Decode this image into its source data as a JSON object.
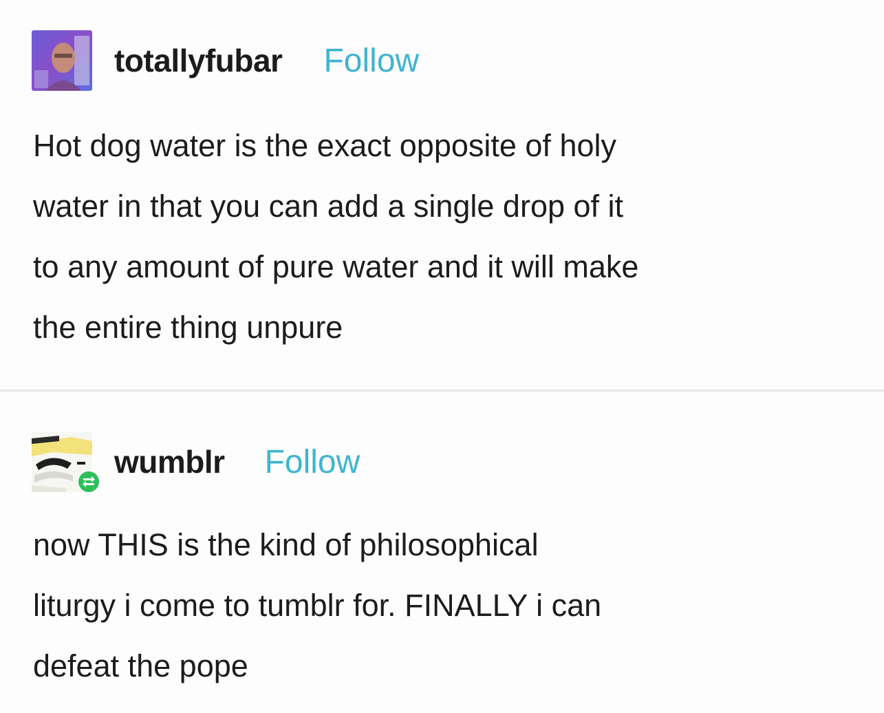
{
  "posts": [
    {
      "username": "totallyfubar",
      "follow_label": "Follow",
      "body_lines": [
        "Hot dog water is the exact opposite of holy",
        "water in that you can add a single drop of it",
        "to any amount of pure water and it will make",
        "the entire thing unpure"
      ]
    },
    {
      "username": "wumblr",
      "follow_label": "Follow",
      "body_lines": [
        "now THIS is the kind of philosophical",
        "liturgy i come to tumblr for. FINALLY i can",
        "defeat the pope"
      ]
    }
  ],
  "colors": {
    "follow": "#3fb4d0",
    "reblog_badge": "#2fbf5a",
    "background": "#fdfdfd"
  },
  "icons": {
    "post_1_avatar": "user-photo-avatar",
    "post_2_avatar": "cartoon-avatar",
    "post_2_badge": "reblog-icon"
  }
}
